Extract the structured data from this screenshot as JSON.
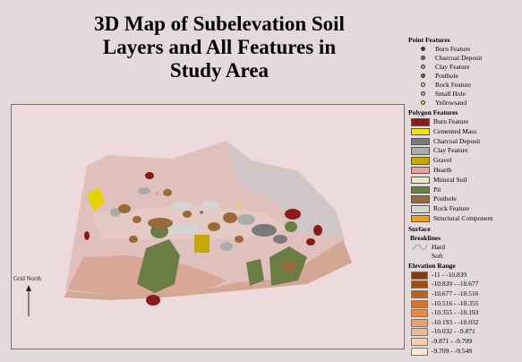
{
  "title": [
    "3D Map of Subelevation Soil",
    "Layers and All Features in",
    "Study Area"
  ],
  "north_label": "Grid North",
  "legend": {
    "point_features": {
      "heading": "Point Features",
      "items": [
        {
          "label": "Burn Feature",
          "color": "#8b1a1a"
        },
        {
          "label": "Charcoal Deposit",
          "color": "#6e6e6e"
        },
        {
          "label": "Clay Feature",
          "color": "#a9a9a9"
        },
        {
          "label": "Posthole",
          "color": "#8b5a2b"
        },
        {
          "label": "Rock Feature",
          "color": "#d0d0d0"
        },
        {
          "label": "Small Hole",
          "color": "#e0a0a0"
        },
        {
          "label": "Yellowsand",
          "color": "#f2e000"
        }
      ]
    },
    "polygon_features": {
      "heading": "Polygon Features",
      "items": [
        {
          "label": "Burn Feature",
          "color": "#8b1a1a"
        },
        {
          "label": "Cemented Mass",
          "color": "#f2e010"
        },
        {
          "label": "Charcoal Deposit",
          "color": "#7a7a7a"
        },
        {
          "label": "Clay Feature",
          "color": "#ababab"
        },
        {
          "label": "Gravel",
          "color": "#c8a800"
        },
        {
          "label": "Hearth",
          "color": "#e8a0a0"
        },
        {
          "label": "Mineral Soil",
          "color": "#e8e8c8"
        },
        {
          "label": "Pit",
          "color": "#6b7d45"
        },
        {
          "label": "Posthole",
          "color": "#9a6a3a"
        },
        {
          "label": "Rock Feature",
          "color": "#d4d4d4"
        },
        {
          "label": "Structural Component",
          "color": "#f0a020"
        }
      ]
    },
    "surface": {
      "heading": "Surface",
      "subheading": "Breaklines",
      "items": [
        {
          "label": "Hard",
          "color": "#9a9a9a"
        },
        {
          "label": "Soft",
          "color": "#e0d0d0"
        }
      ]
    },
    "elevation": {
      "heading": "Elevation Range",
      "items": [
        {
          "label": "-11 - -10.839",
          "color": "#7a3e10"
        },
        {
          "label": "-10.839 - -10.677",
          "color": "#9e4e14"
        },
        {
          "label": "-10.677 - -10.516",
          "color": "#bf5e1e"
        },
        {
          "label": "-10.516 - -10.355",
          "color": "#d8742e"
        },
        {
          "label": "-10.355 - -10.193",
          "color": "#e68a48"
        },
        {
          "label": "-10.193 - -10.032",
          "color": "#eda06a"
        },
        {
          "label": "-10.032 - -9.871",
          "color": "#f2b88a"
        },
        {
          "label": "-9.871 - -9.709",
          "color": "#f7d0b0"
        },
        {
          "label": "-9.709 - -9.548",
          "color": "#fbe6d6"
        }
      ]
    }
  },
  "map": {
    "terrain_top_color": "#dfc0bd",
    "terrain_side_color": "#d2a895",
    "terrain_ridge_color": "#cfc6c8",
    "feature_colors": {
      "burn": "#8b1a1a",
      "pit": "#6b7d45",
      "posthole": "#9a6a3a",
      "clay": "#ababab",
      "charcoal": "#7a7a7a",
      "cemented": "#e6d200",
      "gravel": "#c8a800",
      "rock": "#d4d4d4",
      "hearth": "#e8a0a0"
    }
  }
}
